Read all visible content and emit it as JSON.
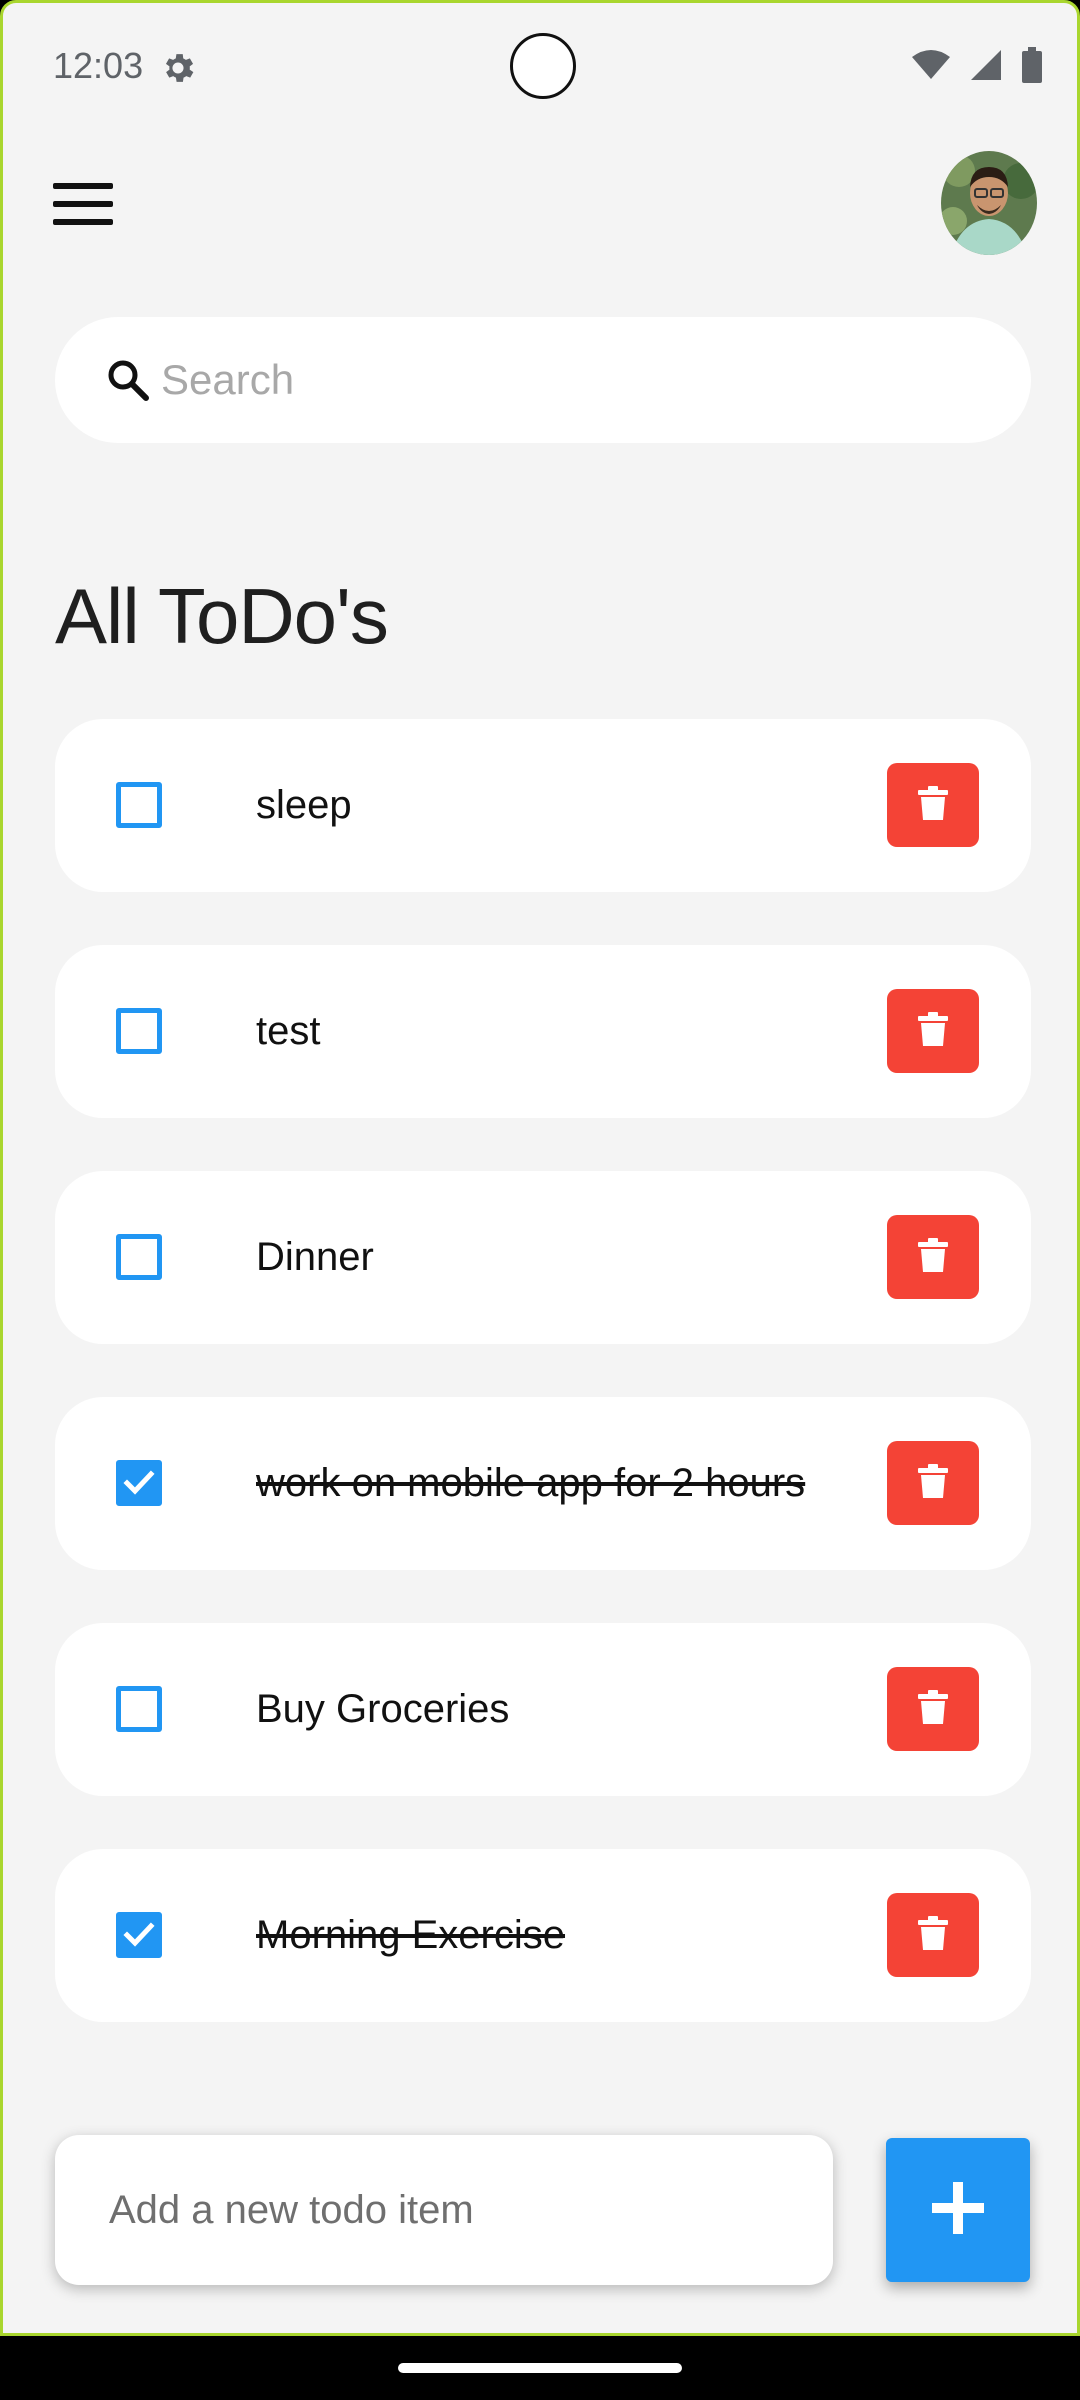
{
  "status_bar": {
    "time": "12:03",
    "icons": [
      "settings-gear-icon",
      "wifi-icon",
      "signal-icon",
      "battery-icon"
    ]
  },
  "app_bar": {
    "menu_icon": "hamburger-menu-icon",
    "avatar": "user-avatar-photo"
  },
  "search": {
    "placeholder": "Search",
    "value": "",
    "icon": "search-icon"
  },
  "page": {
    "title": "All ToDo's"
  },
  "todos": [
    {
      "text": "sleep",
      "done": false
    },
    {
      "text": "test",
      "done": false
    },
    {
      "text": "Dinner",
      "done": false
    },
    {
      "text": "work on mobile app for 2 hours",
      "done": true
    },
    {
      "text": "Buy Groceries",
      "done": false
    },
    {
      "text": "Morning Exercise",
      "done": true
    }
  ],
  "add_todo": {
    "placeholder": "Add a new todo item",
    "value": "",
    "button_icon": "plus-icon"
  },
  "colors": {
    "accent": "#2196F3",
    "delete": "#F44336",
    "background": "#F4F4F4",
    "card": "#FFFFFF",
    "frame": "#A9D62E"
  }
}
